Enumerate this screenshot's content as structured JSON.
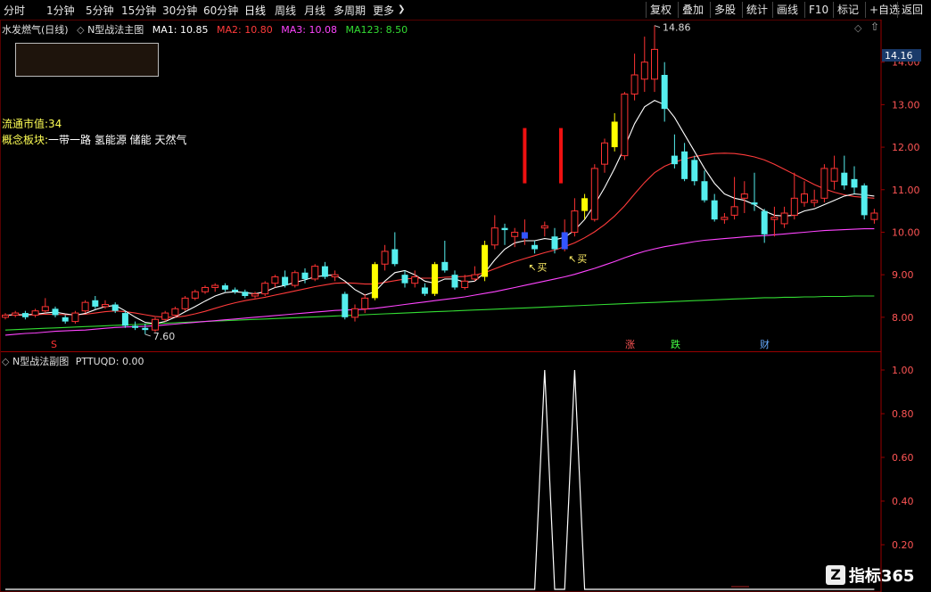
{
  "toolbar": {
    "periods": [
      "分时",
      "1分钟",
      "5分钟",
      "15分钟",
      "30分钟",
      "60分钟",
      "日线",
      "周线",
      "月线",
      "多周期",
      "更多"
    ],
    "active_period": "日线",
    "more_chevron": "❯",
    "right_buttons": [
      "复权",
      "叠加",
      "多股",
      "统计",
      "画线",
      "F10",
      "标记",
      "+自选",
      "返回"
    ]
  },
  "main_panel": {
    "stock_name": "水发燃气(日线)",
    "indicator_name": "N型战法主图",
    "ma": [
      {
        "label": "MA1: 10.85",
        "color": "#ffffff"
      },
      {
        "label": "MA2: 10.80",
        "color": "#ff3b3b"
      },
      {
        "label": "MA3: 10.08",
        "color": "#ff44ff"
      },
      {
        "label": "MA123: 8.50",
        "color": "#33dd33"
      }
    ],
    "float_cap_label": "流通市值:34",
    "concept_label": "概念板块:",
    "concept_value": "一带一路 氢能源 储能 天然气",
    "high_label": "14.86",
    "low_label": "7.60",
    "current_price_tag": "14.16",
    "buy_labels": [
      "买",
      "买"
    ],
    "markers": [
      {
        "text": "S",
        "color": "#ff3333"
      },
      {
        "text": "涨",
        "color": "#ff5555"
      },
      {
        "text": "跌",
        "color": "#44ff44"
      },
      {
        "text": "财",
        "color": "#66aaff"
      }
    ],
    "y_ticks": [
      "14.00",
      "13.00",
      "12.00",
      "11.00",
      "10.00",
      "9.00",
      "8.00"
    ]
  },
  "sub_panel": {
    "title": "N型战法副图",
    "value_label": "PTTUQD: 0.00",
    "y_ticks": [
      "1.00",
      "0.80",
      "0.60",
      "0.40",
      "0.20"
    ]
  },
  "watermark": "指标365",
  "colors": {
    "up": "#ff3333",
    "down": "#55eeee",
    "highlight": "#ffff00",
    "signal_bar": "#3355ff",
    "grid": "#990000",
    "axis_text": "#ff5555"
  },
  "chart_data": {
    "type": "candlestick",
    "ylim": [
      7.2,
      15.0
    ],
    "candles": [
      [
        8.0,
        8.05,
        7.95,
        8.1
      ],
      [
        8.05,
        8.1,
        8.0,
        8.15
      ],
      [
        8.1,
        8.0,
        7.95,
        8.15
      ],
      [
        8.05,
        8.15,
        8.0,
        8.2
      ],
      [
        8.15,
        8.25,
        8.1,
        8.45
      ],
      [
        8.2,
        8.05,
        8.0,
        8.25
      ],
      [
        8.0,
        7.9,
        7.85,
        8.05
      ],
      [
        7.9,
        8.1,
        7.85,
        8.15
      ],
      [
        8.15,
        8.35,
        8.1,
        8.4
      ],
      [
        8.4,
        8.25,
        8.2,
        8.5
      ],
      [
        8.25,
        8.3,
        8.2,
        8.4
      ],
      [
        8.3,
        8.15,
        8.1,
        8.35
      ],
      [
        8.1,
        7.8,
        7.75,
        8.15
      ],
      [
        7.8,
        7.75,
        7.7,
        7.9
      ],
      [
        7.75,
        7.7,
        7.6,
        7.85
      ],
      [
        7.7,
        7.95,
        7.65,
        8.0
      ],
      [
        7.95,
        8.1,
        7.9,
        8.15
      ],
      [
        8.05,
        8.2,
        8.0,
        8.25
      ],
      [
        8.2,
        8.45,
        8.15,
        8.5
      ],
      [
        8.45,
        8.6,
        8.4,
        8.65
      ],
      [
        8.6,
        8.7,
        8.55,
        8.75
      ],
      [
        8.7,
        8.75,
        8.6,
        8.8
      ],
      [
        8.75,
        8.65,
        8.6,
        8.8
      ],
      [
        8.65,
        8.6,
        8.55,
        8.7
      ],
      [
        8.6,
        8.5,
        8.45,
        8.65
      ],
      [
        8.5,
        8.55,
        8.45,
        8.6
      ],
      [
        8.55,
        8.8,
        8.5,
        8.85
      ],
      [
        8.8,
        8.95,
        8.7,
        9.0
      ],
      [
        8.95,
        8.75,
        8.7,
        9.1
      ],
      [
        8.75,
        9.05,
        8.7,
        9.1
      ],
      [
        9.05,
        8.9,
        8.8,
        9.15
      ],
      [
        8.9,
        9.2,
        8.85,
        9.25
      ],
      [
        9.2,
        8.95,
        8.9,
        9.3
      ],
      [
        8.95,
        9.0,
        8.85,
        9.1
      ],
      [
        8.55,
        8.0,
        7.95,
        8.6
      ],
      [
        8.0,
        8.2,
        7.9,
        8.3
      ],
      [
        8.2,
        8.45,
        8.1,
        8.55
      ],
      [
        8.45,
        9.25,
        8.4,
        9.3
      ],
      [
        9.25,
        9.55,
        9.1,
        9.7
      ],
      [
        9.6,
        9.25,
        9.2,
        10.0
      ],
      [
        9.0,
        8.8,
        8.7,
        9.1
      ],
      [
        8.8,
        8.95,
        8.7,
        9.1
      ],
      [
        8.7,
        8.55,
        8.5,
        8.8
      ],
      [
        8.55,
        9.25,
        8.5,
        9.3
      ],
      [
        9.3,
        9.1,
        9.05,
        9.8
      ],
      [
        9.0,
        8.7,
        8.65,
        9.1
      ],
      [
        8.7,
        8.85,
        8.65,
        9.0
      ],
      [
        8.9,
        9.0,
        8.85,
        9.2
      ],
      [
        8.95,
        9.7,
        8.85,
        9.8
      ],
      [
        9.7,
        10.1,
        9.6,
        10.4
      ],
      [
        10.1,
        10.05,
        9.7,
        10.2
      ],
      [
        9.9,
        10.0,
        9.65,
        10.1
      ],
      [
        9.85,
        10.0,
        9.7,
        10.3
      ],
      [
        9.7,
        9.6,
        9.5,
        9.8
      ],
      [
        10.1,
        10.15,
        9.9,
        10.25
      ],
      [
        9.9,
        9.6,
        9.5,
        10.1
      ],
      [
        9.6,
        10.0,
        9.55,
        10.3
      ],
      [
        10.0,
        10.5,
        9.9,
        10.8
      ],
      [
        10.5,
        10.8,
        10.3,
        10.9
      ],
      [
        10.3,
        11.5,
        10.25,
        11.6
      ],
      [
        11.6,
        12.1,
        11.4,
        12.2
      ],
      [
        12.0,
        12.6,
        11.9,
        12.8
      ],
      [
        11.8,
        13.25,
        11.7,
        13.3
      ],
      [
        13.25,
        13.7,
        13.1,
        14.2
      ],
      [
        13.6,
        14.0,
        13.3,
        14.6
      ],
      [
        13.6,
        14.3,
        13.3,
        14.86
      ],
      [
        13.7,
        12.9,
        12.6,
        14.0
      ],
      [
        11.8,
        11.6,
        11.5,
        12.3
      ],
      [
        11.9,
        11.25,
        11.2,
        12.1
      ],
      [
        11.7,
        11.2,
        11.1,
        11.8
      ],
      [
        11.2,
        10.75,
        10.7,
        11.45
      ],
      [
        10.75,
        10.3,
        10.25,
        10.9
      ],
      [
        10.3,
        10.35,
        10.2,
        10.45
      ],
      [
        10.4,
        10.6,
        10.3,
        11.3
      ],
      [
        10.8,
        10.9,
        10.45,
        11.2
      ],
      [
        10.7,
        10.65,
        10.5,
        11.4
      ],
      [
        10.5,
        9.95,
        9.75,
        10.55
      ],
      [
        10.3,
        10.35,
        9.9,
        10.6
      ],
      [
        10.2,
        10.45,
        10.1,
        10.6
      ],
      [
        10.4,
        10.8,
        10.3,
        11.4
      ],
      [
        10.7,
        10.9,
        10.6,
        11.2
      ],
      [
        10.7,
        10.75,
        10.6,
        11.0
      ],
      [
        10.8,
        11.5,
        10.7,
        11.6
      ],
      [
        11.2,
        11.5,
        11.0,
        11.8
      ],
      [
        11.4,
        11.1,
        11.0,
        11.8
      ],
      [
        11.25,
        11.05,
        10.9,
        11.55
      ],
      [
        11.1,
        10.4,
        10.3,
        11.15
      ],
      [
        10.3,
        10.45,
        10.2,
        10.55
      ]
    ],
    "highlight_indices": [
      37,
      43,
      48,
      58,
      61
    ],
    "signal_indices": [
      52,
      56
    ],
    "red_signal_indices": [
      52,
      55
    ],
    "ma1": [
      8.05,
      8.06,
      8.06,
      8.07,
      8.1,
      8.12,
      8.08,
      8.05,
      8.09,
      8.18,
      8.25,
      8.28,
      8.15,
      8.0,
      7.88,
      7.85,
      7.9,
      8.0,
      8.13,
      8.25,
      8.38,
      8.5,
      8.58,
      8.6,
      8.58,
      8.55,
      8.6,
      8.7,
      8.75,
      8.82,
      8.88,
      8.95,
      8.98,
      9.0,
      8.85,
      8.65,
      8.52,
      8.6,
      8.85,
      9.05,
      9.1,
      9.0,
      8.85,
      8.8,
      8.9,
      8.9,
      8.82,
      8.85,
      9.05,
      9.35,
      9.6,
      9.75,
      9.8,
      9.8,
      9.85,
      9.82,
      9.88,
      10.05,
      10.3,
      10.65,
      11.05,
      11.5,
      12.0,
      12.55,
      12.95,
      13.1,
      13.0,
      12.7,
      12.3,
      11.9,
      11.5,
      11.15,
      10.9,
      10.8,
      10.75,
      10.65,
      10.5,
      10.4,
      10.38,
      10.4,
      10.5,
      10.55,
      10.65,
      10.75,
      10.85,
      10.9,
      10.88,
      10.85
    ],
    "ma2": [
      8.05,
      8.05,
      8.05,
      8.06,
      8.07,
      8.07,
      8.06,
      8.06,
      8.07,
      8.1,
      8.13,
      8.15,
      8.13,
      8.1,
      8.06,
      8.02,
      8.0,
      8.0,
      8.03,
      8.08,
      8.14,
      8.21,
      8.28,
      8.34,
      8.39,
      8.43,
      8.47,
      8.52,
      8.57,
      8.62,
      8.67,
      8.72,
      8.76,
      8.8,
      8.81,
      8.8,
      8.78,
      8.78,
      8.82,
      8.86,
      8.9,
      8.92,
      8.92,
      8.92,
      8.94,
      8.95,
      8.96,
      8.99,
      9.05,
      9.14,
      9.23,
      9.31,
      9.38,
      9.45,
      9.52,
      9.58,
      9.66,
      9.75,
      9.87,
      10.01,
      10.18,
      10.38,
      10.62,
      10.9,
      11.17,
      11.4,
      11.55,
      11.65,
      11.72,
      11.78,
      11.82,
      11.85,
      11.86,
      11.85,
      11.82,
      11.77,
      11.7,
      11.6,
      11.48,
      11.36,
      11.24,
      11.12,
      11.02,
      10.94,
      10.88,
      10.84,
      10.82,
      10.8
    ],
    "ma3": [
      7.58,
      7.6,
      7.62,
      7.63,
      7.65,
      7.67,
      7.68,
      7.69,
      7.7,
      7.72,
      7.74,
      7.76,
      7.77,
      7.78,
      7.79,
      7.8,
      7.82,
      7.84,
      7.86,
      7.88,
      7.9,
      7.92,
      7.94,
      7.96,
      7.98,
      8.0,
      8.02,
      8.04,
      8.06,
      8.08,
      8.1,
      8.12,
      8.14,
      8.16,
      8.17,
      8.18,
      8.19,
      8.21,
      8.24,
      8.27,
      8.3,
      8.33,
      8.36,
      8.39,
      8.42,
      8.45,
      8.48,
      8.52,
      8.56,
      8.6,
      8.65,
      8.7,
      8.75,
      8.8,
      8.85,
      8.9,
      8.95,
      9.01,
      9.08,
      9.15,
      9.23,
      9.31,
      9.4,
      9.48,
      9.55,
      9.61,
      9.66,
      9.7,
      9.74,
      9.78,
      9.81,
      9.83,
      9.85,
      9.87,
      9.89,
      9.91,
      9.92,
      9.94,
      9.96,
      9.98,
      10.0,
      10.02,
      10.04,
      10.05,
      10.06,
      10.07,
      10.08,
      10.08
    ],
    "ma123": [
      7.7,
      7.71,
      7.72,
      7.73,
      7.74,
      7.75,
      7.76,
      7.77,
      7.78,
      7.79,
      7.8,
      7.81,
      7.82,
      7.83,
      7.84,
      7.85,
      7.86,
      7.87,
      7.88,
      7.89,
      7.9,
      7.91,
      7.92,
      7.93,
      7.94,
      7.95,
      7.96,
      7.97,
      7.98,
      7.99,
      8.0,
      8.01,
      8.02,
      8.03,
      8.04,
      8.05,
      8.06,
      8.07,
      8.08,
      8.09,
      8.1,
      8.11,
      8.12,
      8.13,
      8.14,
      8.15,
      8.16,
      8.17,
      8.18,
      8.19,
      8.2,
      8.21,
      8.22,
      8.23,
      8.24,
      8.25,
      8.26,
      8.27,
      8.28,
      8.29,
      8.3,
      8.31,
      8.32,
      8.33,
      8.34,
      8.35,
      8.36,
      8.37,
      8.38,
      8.39,
      8.4,
      8.41,
      8.42,
      8.43,
      8.44,
      8.45,
      8.46,
      8.46,
      8.47,
      8.47,
      8.48,
      8.48,
      8.49,
      8.49,
      8.49,
      8.5,
      8.5,
      8.5
    ],
    "sub_series": [
      0,
      0,
      0,
      0,
      0,
      0,
      0,
      0,
      0,
      0,
      0,
      0,
      0,
      0,
      0,
      0,
      0,
      0,
      0,
      0,
      0,
      0,
      0,
      0,
      0,
      0,
      0,
      0,
      0,
      0,
      0,
      0,
      0,
      0,
      0,
      0,
      0,
      0,
      0,
      0,
      0,
      0,
      0,
      0,
      0,
      0,
      0,
      0,
      0,
      0,
      0,
      0,
      0,
      0,
      1,
      0,
      0,
      1,
      0,
      0,
      0,
      0,
      0,
      0,
      0,
      0,
      0,
      0,
      0,
      0,
      0,
      0,
      0,
      0,
      0,
      0,
      0,
      0,
      0,
      0,
      0,
      0,
      0,
      0,
      0,
      0,
      0,
      0
    ],
    "sub_ylim": [
      0,
      1.0
    ]
  }
}
